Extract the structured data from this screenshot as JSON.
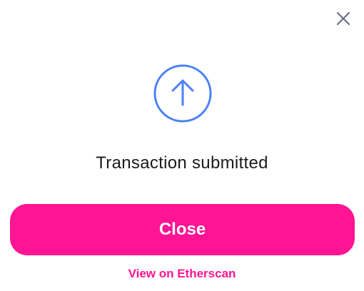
{
  "modal": {
    "close_icon": "close-icon",
    "status_icon": "arrow-up-circle-icon",
    "status_text": "Transaction submitted",
    "primary_button_label": "Close",
    "link_label": "View on Etherscan"
  },
  "colors": {
    "accent": "#ff1493",
    "icon_blue": "#4a82f5",
    "close_icon": "#6b6f85",
    "text": "#1a1a1a",
    "background": "#ffffff"
  }
}
